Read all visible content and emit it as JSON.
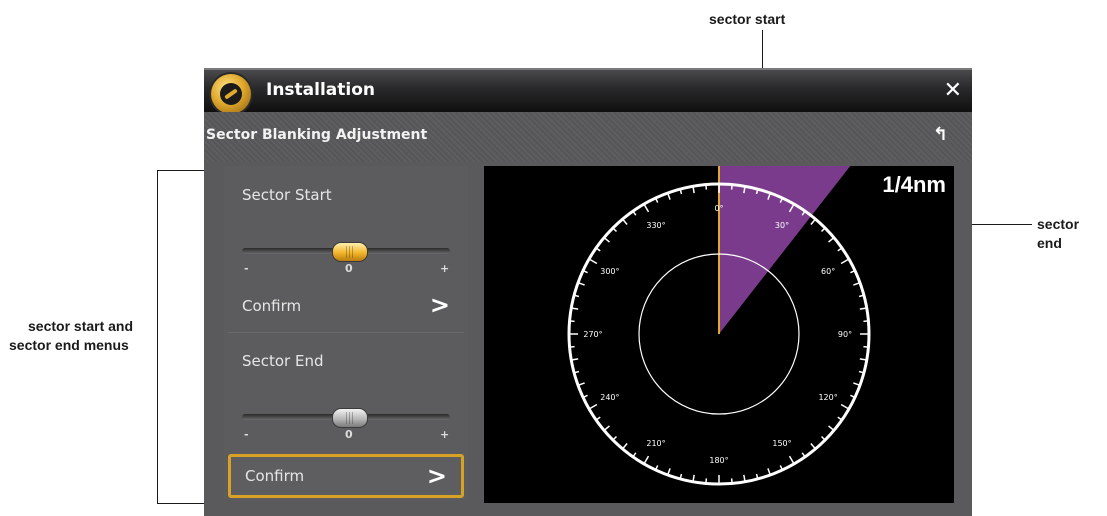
{
  "callouts": {
    "sector_start": "sector start",
    "sector_end": "sector end",
    "menus_line1": "sector start and",
    "menus_line2": "sector end menus"
  },
  "titlebar": {
    "title": "Installation",
    "close_icon": "close-icon"
  },
  "subheader": {
    "title": "Sector Blanking Adjustment",
    "back_icon": "back-icon"
  },
  "menu": {
    "sector_start": {
      "label": "Sector Start",
      "value": "0",
      "min_label": "-",
      "max_label": "+",
      "confirm": "Confirm",
      "arrow": ">"
    },
    "sector_end": {
      "label": "Sector End",
      "value": "0",
      "min_label": "-",
      "max_label": "+",
      "confirm": "Confirm",
      "arrow": ">"
    }
  },
  "radar": {
    "range": "1/4nm",
    "bearing_labels": [
      "0°",
      "30°",
      "60°",
      "90°",
      "120°",
      "150°",
      "180°",
      "210°",
      "240°",
      "270°",
      "300°",
      "330°"
    ],
    "sector_start_deg": 0,
    "sector_end_deg": 38
  },
  "colors": {
    "sector_fill": "#7a3b8c",
    "focus_outline": "#d8a325",
    "start_line": "#e0a92c"
  }
}
